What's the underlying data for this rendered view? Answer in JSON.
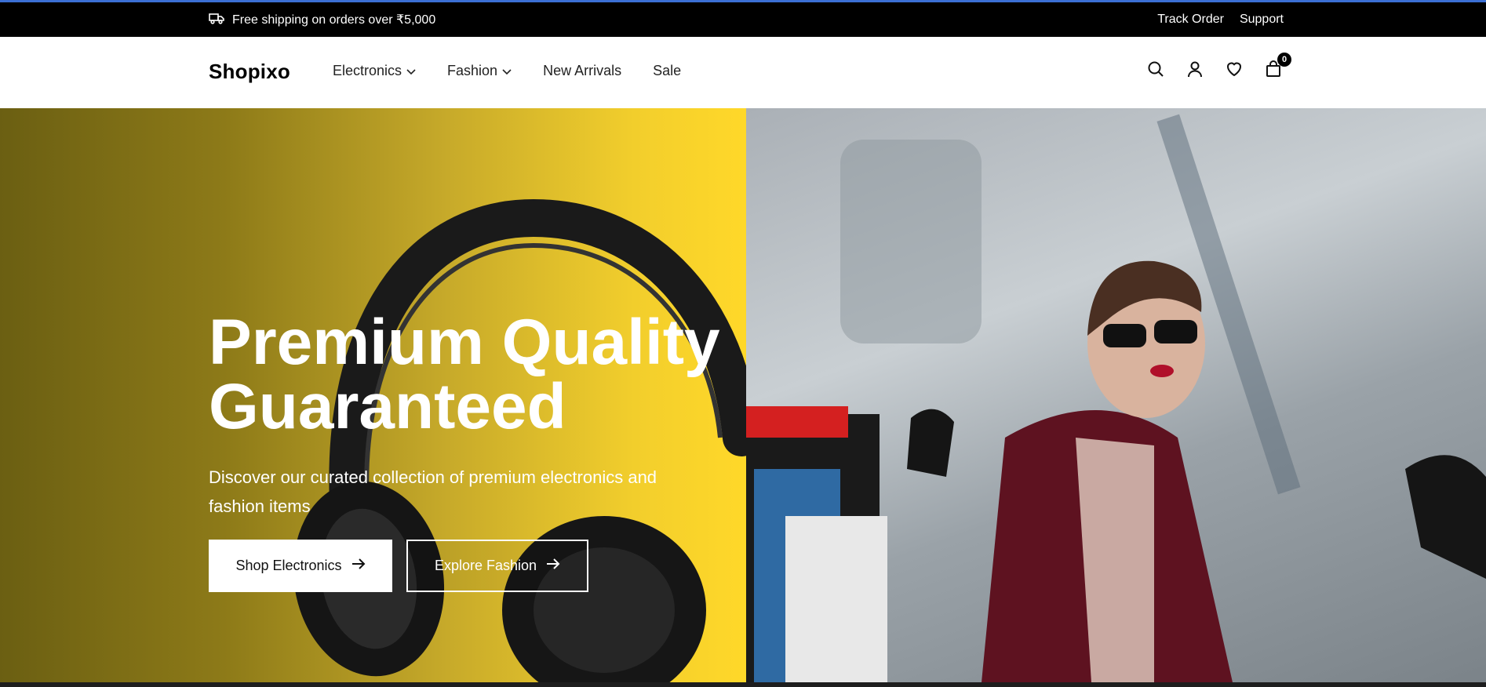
{
  "announcement": {
    "text": "Free shipping on orders over ₹5,000",
    "icon": "truck-icon",
    "links": [
      "Track Order",
      "Support"
    ]
  },
  "header": {
    "logo": "Shopixo",
    "nav": [
      {
        "label": "Electronics",
        "dropdown": true
      },
      {
        "label": "Fashion",
        "dropdown": true
      },
      {
        "label": "New Arrivals",
        "dropdown": false
      },
      {
        "label": "Sale",
        "dropdown": false
      }
    ],
    "icons": [
      "search-icon",
      "user-icon",
      "heart-icon",
      "cart-icon"
    ],
    "cart_count": "0"
  },
  "hero": {
    "title": "Premium Quality Guaranteed",
    "subtitle": "Discover our curated collection of premium electronics and fashion items",
    "buttons": {
      "primary": "Shop Electronics",
      "secondary": "Explore Fashion"
    }
  },
  "colors": {
    "announcement_bg": "#000000",
    "accent_line": "#3b6fd4",
    "hero_left_yellow": "#ffd829",
    "hero_left_olive": "#6b5f12"
  }
}
